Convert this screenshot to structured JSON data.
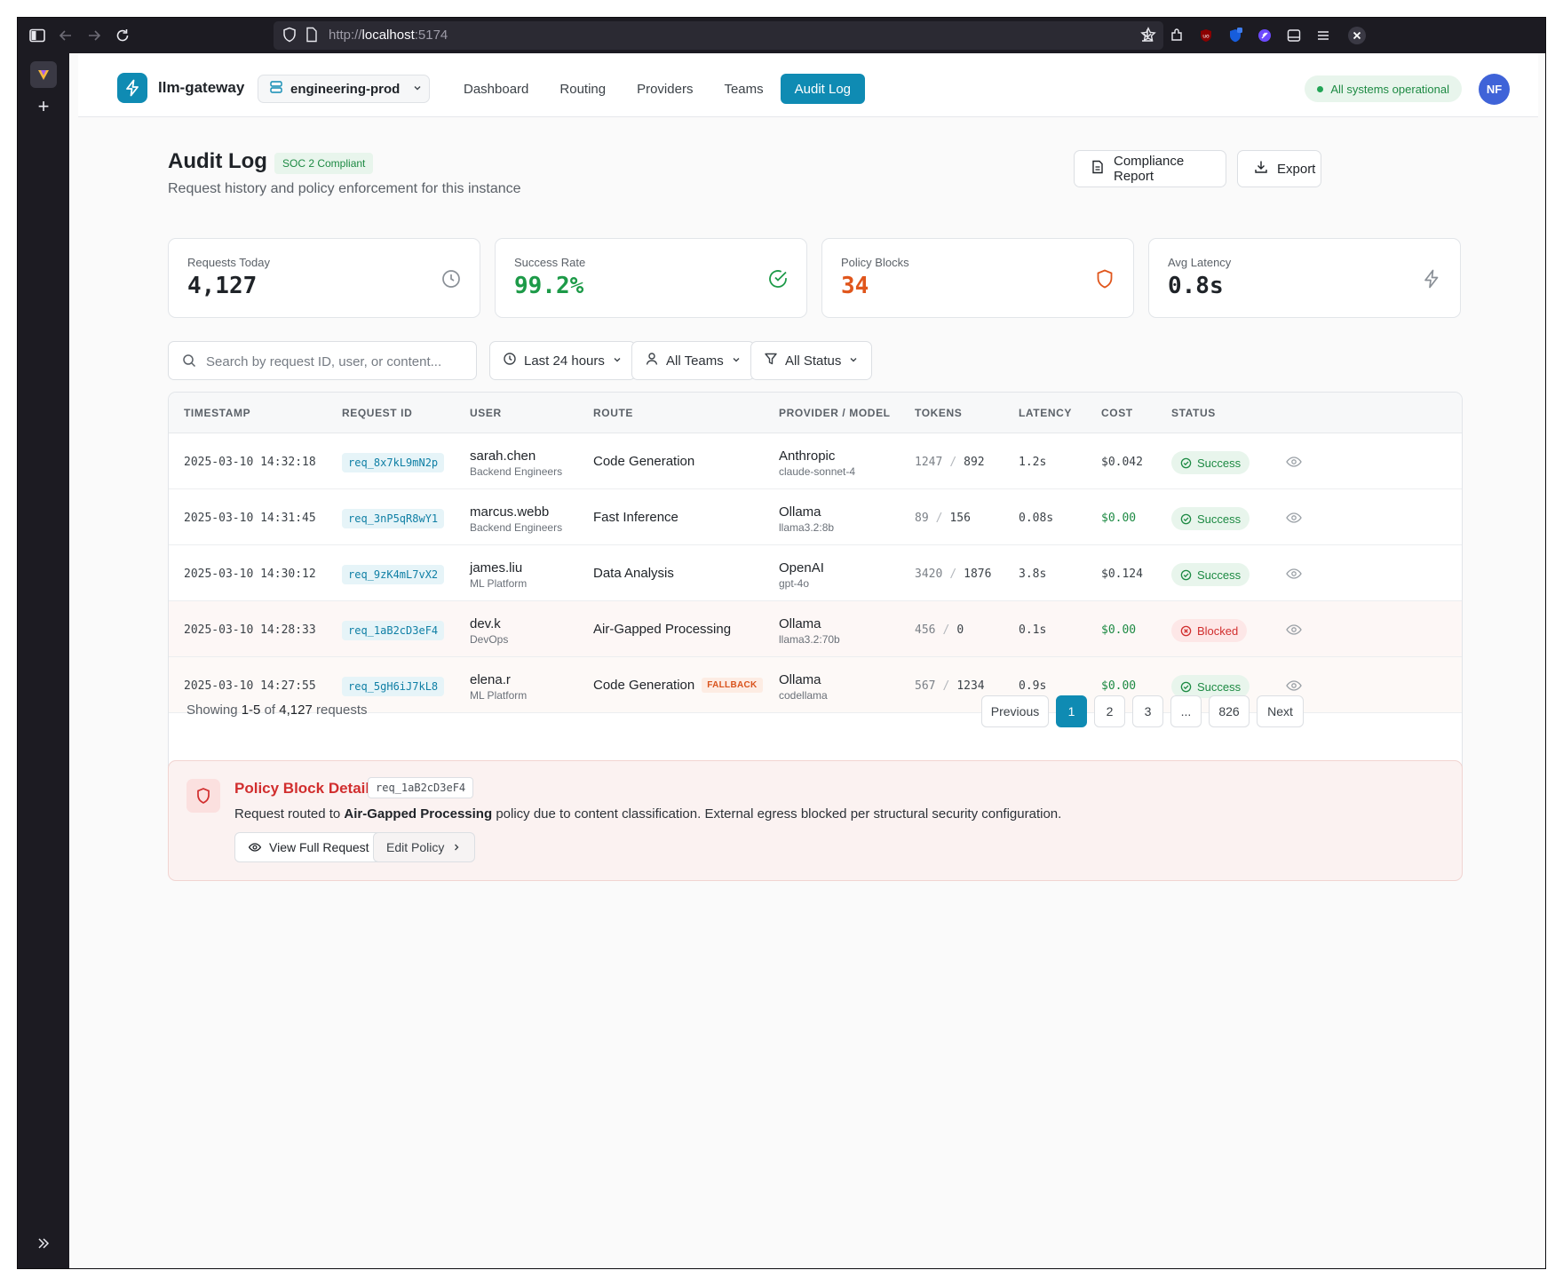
{
  "browser": {
    "url_protocol": "http://",
    "url_host": "localhost",
    "url_port": ":5174"
  },
  "header": {
    "brand": "llm-gateway",
    "environment": "engineering-prod",
    "nav": [
      "Dashboard",
      "Routing",
      "Providers",
      "Teams",
      "Audit Log"
    ],
    "active_nav": "Audit Log",
    "system_status": "All systems operational",
    "avatar_initials": "NF"
  },
  "page": {
    "title": "Audit Log",
    "badge": "SOC 2 Compliant",
    "subtitle": "Request history and policy enforcement for this instance",
    "compliance_button": "Compliance Report",
    "export_button": "Export"
  },
  "stats": [
    {
      "label": "Requests Today",
      "value": "4,127",
      "color": "#1f2328",
      "icon": "clock-icon"
    },
    {
      "label": "Success Rate",
      "value": "99.2%",
      "color": "#1d9a48",
      "icon": "check-circle-icon"
    },
    {
      "label": "Policy Blocks",
      "value": "34",
      "color": "#e0561c",
      "icon": "shield-icon"
    },
    {
      "label": "Avg Latency",
      "value": "0.8s",
      "color": "#1f2328",
      "icon": "zap-icon"
    }
  ],
  "filters": {
    "search_placeholder": "Search by request ID, user, or content...",
    "time_range": "Last 24 hours",
    "teams": "All Teams",
    "status": "All Status"
  },
  "table": {
    "columns": [
      "TIMESTAMP",
      "REQUEST ID",
      "USER",
      "ROUTE",
      "PROVIDER / MODEL",
      "TOKENS",
      "LATENCY",
      "COST",
      "STATUS"
    ],
    "rows": [
      {
        "timestamp": "2025-03-10 14:32:18",
        "request_id": "req_8x7kL9mN2p",
        "user": "sarah.chen",
        "team": "Backend Engineers",
        "route": "Code Generation",
        "fallback": "",
        "provider": "Anthropic",
        "model": "claude-sonnet-4",
        "tokens_in": "1247",
        "tokens_out": "892",
        "latency": "1.2s",
        "cost": "$0.042",
        "status": "Success"
      },
      {
        "timestamp": "2025-03-10 14:31:45",
        "request_id": "req_3nP5qR8wY1",
        "user": "marcus.webb",
        "team": "Backend Engineers",
        "route": "Fast Inference",
        "fallback": "",
        "provider": "Ollama",
        "model": "llama3.2:8b",
        "tokens_in": "89",
        "tokens_out": "156",
        "latency": "0.08s",
        "cost": "$0.00",
        "status": "Success"
      },
      {
        "timestamp": "2025-03-10 14:30:12",
        "request_id": "req_9zK4mL7vX2",
        "user": "james.liu",
        "team": "ML Platform",
        "route": "Data Analysis",
        "fallback": "",
        "provider": "OpenAI",
        "model": "gpt-4o",
        "tokens_in": "3420",
        "tokens_out": "1876",
        "latency": "3.8s",
        "cost": "$0.124",
        "status": "Success"
      },
      {
        "timestamp": "2025-03-10 14:28:33",
        "request_id": "req_1aB2cD3eF4",
        "user": "dev.k",
        "team": "DevOps",
        "route": "Air-Gapped Processing",
        "fallback": "",
        "provider": "Ollama",
        "model": "llama3.2:70b",
        "tokens_in": "456",
        "tokens_out": "0",
        "latency": "0.1s",
        "cost": "$0.00",
        "status": "Blocked"
      },
      {
        "timestamp": "2025-03-10 14:27:55",
        "request_id": "req_5gH6iJ7kL8",
        "user": "elena.r",
        "team": "ML Platform",
        "route": "Code Generation",
        "fallback": "FALLBACK",
        "provider": "Ollama",
        "model": "codellama",
        "tokens_in": "567",
        "tokens_out": "1234",
        "latency": "0.9s",
        "cost": "$0.00",
        "status": "Success"
      }
    ],
    "footer": {
      "showing_prefix": "Showing",
      "range": "1-5",
      "of": "of",
      "total": "4,127",
      "suffix": "requests"
    },
    "pagination": {
      "previous": "Previous",
      "pages": [
        "1",
        "2",
        "3",
        "...",
        "826"
      ],
      "current": "1",
      "next": "Next"
    }
  },
  "policy_block": {
    "title": "Policy Block Details",
    "request_id": "req_1aB2cD3eF4",
    "desc_prefix": "Request routed to",
    "desc_route": "Air-Gapped Processing",
    "desc_suffix": "policy due to content classification. External egress blocked per structural security configuration.",
    "view_button": "View Full Request",
    "edit_button": "Edit Policy"
  }
}
